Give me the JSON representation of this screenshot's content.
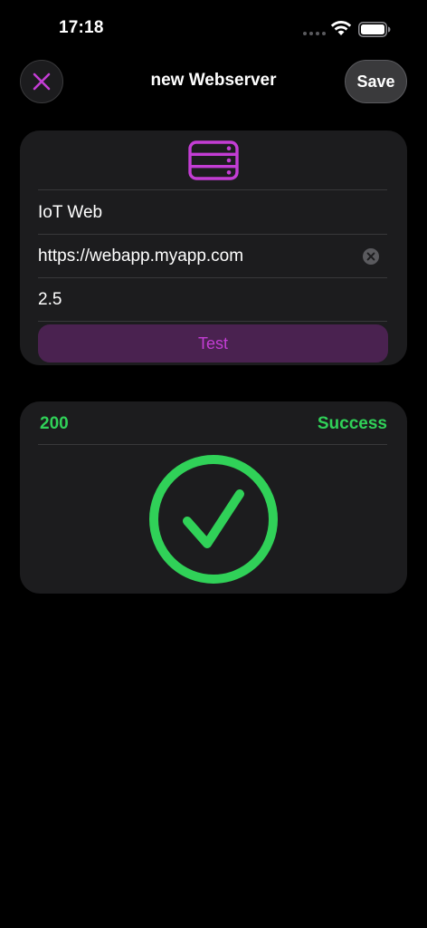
{
  "status_bar": {
    "time": "17:18"
  },
  "nav": {
    "title": "new Webserver",
    "save_label": "Save"
  },
  "form": {
    "name_value": "IoT Web",
    "url_value": "https://webapp.myapp.com",
    "timeout_value": "2.5",
    "test_label": "Test"
  },
  "result": {
    "code": "200",
    "status": "Success"
  },
  "colors": {
    "accent": "#c33dd4",
    "success": "#30d158",
    "card_bg": "#1c1c1e",
    "test_bg": "#4a2250"
  },
  "icons": {
    "close": "close-icon",
    "server": "server-icon",
    "clear": "clear-text-icon",
    "success": "checkmark-circle-icon"
  }
}
